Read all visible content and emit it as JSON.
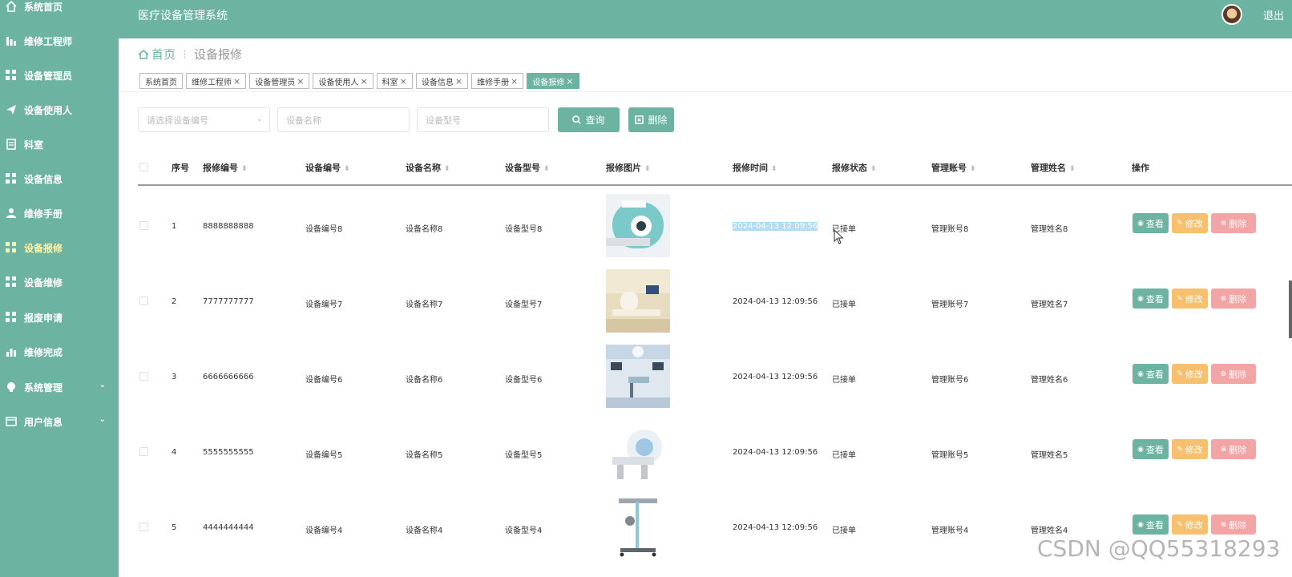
{
  "app": {
    "title": "医疗设备管理系统",
    "logout": "退出"
  },
  "sidebar": {
    "items": [
      {
        "label": "系统首页"
      },
      {
        "label": "维修工程师"
      },
      {
        "label": "设备管理员"
      },
      {
        "label": "设备使用人"
      },
      {
        "label": "科室"
      },
      {
        "label": "设备信息"
      },
      {
        "label": "维修手册"
      },
      {
        "label": "设备报修"
      },
      {
        "label": "设备维修"
      },
      {
        "label": "报废申请"
      },
      {
        "label": "维修完成"
      },
      {
        "label": "系统管理"
      },
      {
        "label": "用户信息"
      }
    ],
    "active_color": "#fff4a8"
  },
  "breadcrumb": {
    "home": "首页",
    "current": "设备报修"
  },
  "tags": [
    {
      "label": "系统首页",
      "close": ""
    },
    {
      "label": "维修工程师",
      "close": "×"
    },
    {
      "label": "设备管理员",
      "close": "×"
    },
    {
      "label": "设备使用人",
      "close": "×"
    },
    {
      "label": "科室",
      "close": "×"
    },
    {
      "label": "设备信息",
      "close": "×"
    },
    {
      "label": "维修手册",
      "close": "×"
    },
    {
      "label": "设备报修",
      "close": "×"
    }
  ],
  "search": {
    "device_no_placeholder": "请选择设备编号",
    "device_name_placeholder": "设备名称",
    "device_model_placeholder": "设备型号",
    "query_label": "查询",
    "delete_label": "删除"
  },
  "table": {
    "columns": [
      "序号",
      "报修编号",
      "设备编号",
      "设备名称",
      "设备型号",
      "报修图片",
      "报修时间",
      "报修状态",
      "管理账号",
      "管理姓名",
      "操作"
    ],
    "rows": [
      {
        "idx": "1",
        "repair_no": "8888888888",
        "device_no": "设备编号8",
        "device_name": "设备名称8",
        "model": "设备型号8",
        "time": "2024-04-13 12:09:56",
        "status": "已接单",
        "account": "管理账号8",
        "name": "管理姓名8"
      },
      {
        "idx": "2",
        "repair_no": "7777777777",
        "device_no": "设备编号7",
        "device_name": "设备名称7",
        "model": "设备型号7",
        "time": "2024-04-13 12:09:56",
        "status": "已接单",
        "account": "管理账号7",
        "name": "管理姓名7"
      },
      {
        "idx": "3",
        "repair_no": "6666666666",
        "device_no": "设备编号6",
        "device_name": "设备名称6",
        "model": "设备型号6",
        "time": "2024-04-13 12:09:56",
        "status": "已接单",
        "account": "管理账号6",
        "name": "管理姓名6"
      },
      {
        "idx": "4",
        "repair_no": "5555555555",
        "device_no": "设备编号5",
        "device_name": "设备名称5",
        "model": "设备型号5",
        "time": "2024-04-13 12:09:56",
        "status": "已接单",
        "account": "管理账号5",
        "name": "管理姓名5"
      },
      {
        "idx": "5",
        "repair_no": "4444444444",
        "device_no": "设备编号4",
        "device_name": "设备名称4",
        "model": "设备型号4",
        "time": "2024-04-13 12:09:56",
        "status": "已接单",
        "account": "管理账号4",
        "name": "管理姓名4"
      }
    ],
    "actions": {
      "view": "查看",
      "edit": "修改",
      "delete": "删除"
    }
  },
  "colors": {
    "primary": "#6db3a2",
    "edit": "#f7c06e",
    "delete": "#f3a5a5"
  },
  "watermark": "CSDN @QQ55318293"
}
